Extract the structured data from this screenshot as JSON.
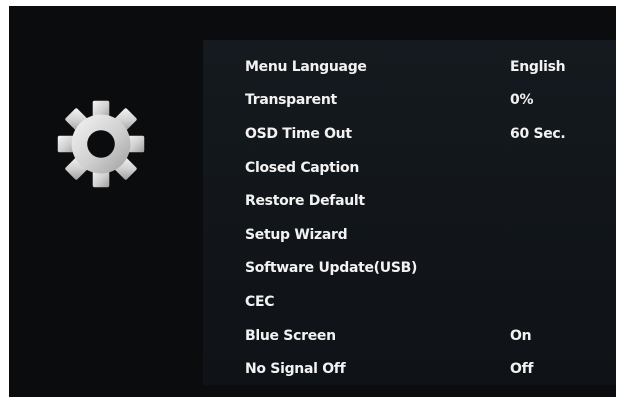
{
  "icon": "gear-icon",
  "menu": {
    "items": [
      {
        "label": "Menu Language",
        "value": "English"
      },
      {
        "label": "Transparent",
        "value": "0%"
      },
      {
        "label": "OSD Time Out",
        "value": "60 Sec."
      },
      {
        "label": "Closed Caption",
        "value": ""
      },
      {
        "label": "Restore Default",
        "value": ""
      },
      {
        "label": "Setup Wizard",
        "value": ""
      },
      {
        "label": "Software Update(USB)",
        "value": ""
      },
      {
        "label": "CEC",
        "value": ""
      },
      {
        "label": "Blue Screen",
        "value": "On"
      },
      {
        "label": "No Signal Off",
        "value": "Off"
      }
    ]
  },
  "colors": {
    "background": "#0b0c0e",
    "panel": "#131920",
    "text": "#f2f2f2",
    "gear": "#d9d9d9"
  }
}
